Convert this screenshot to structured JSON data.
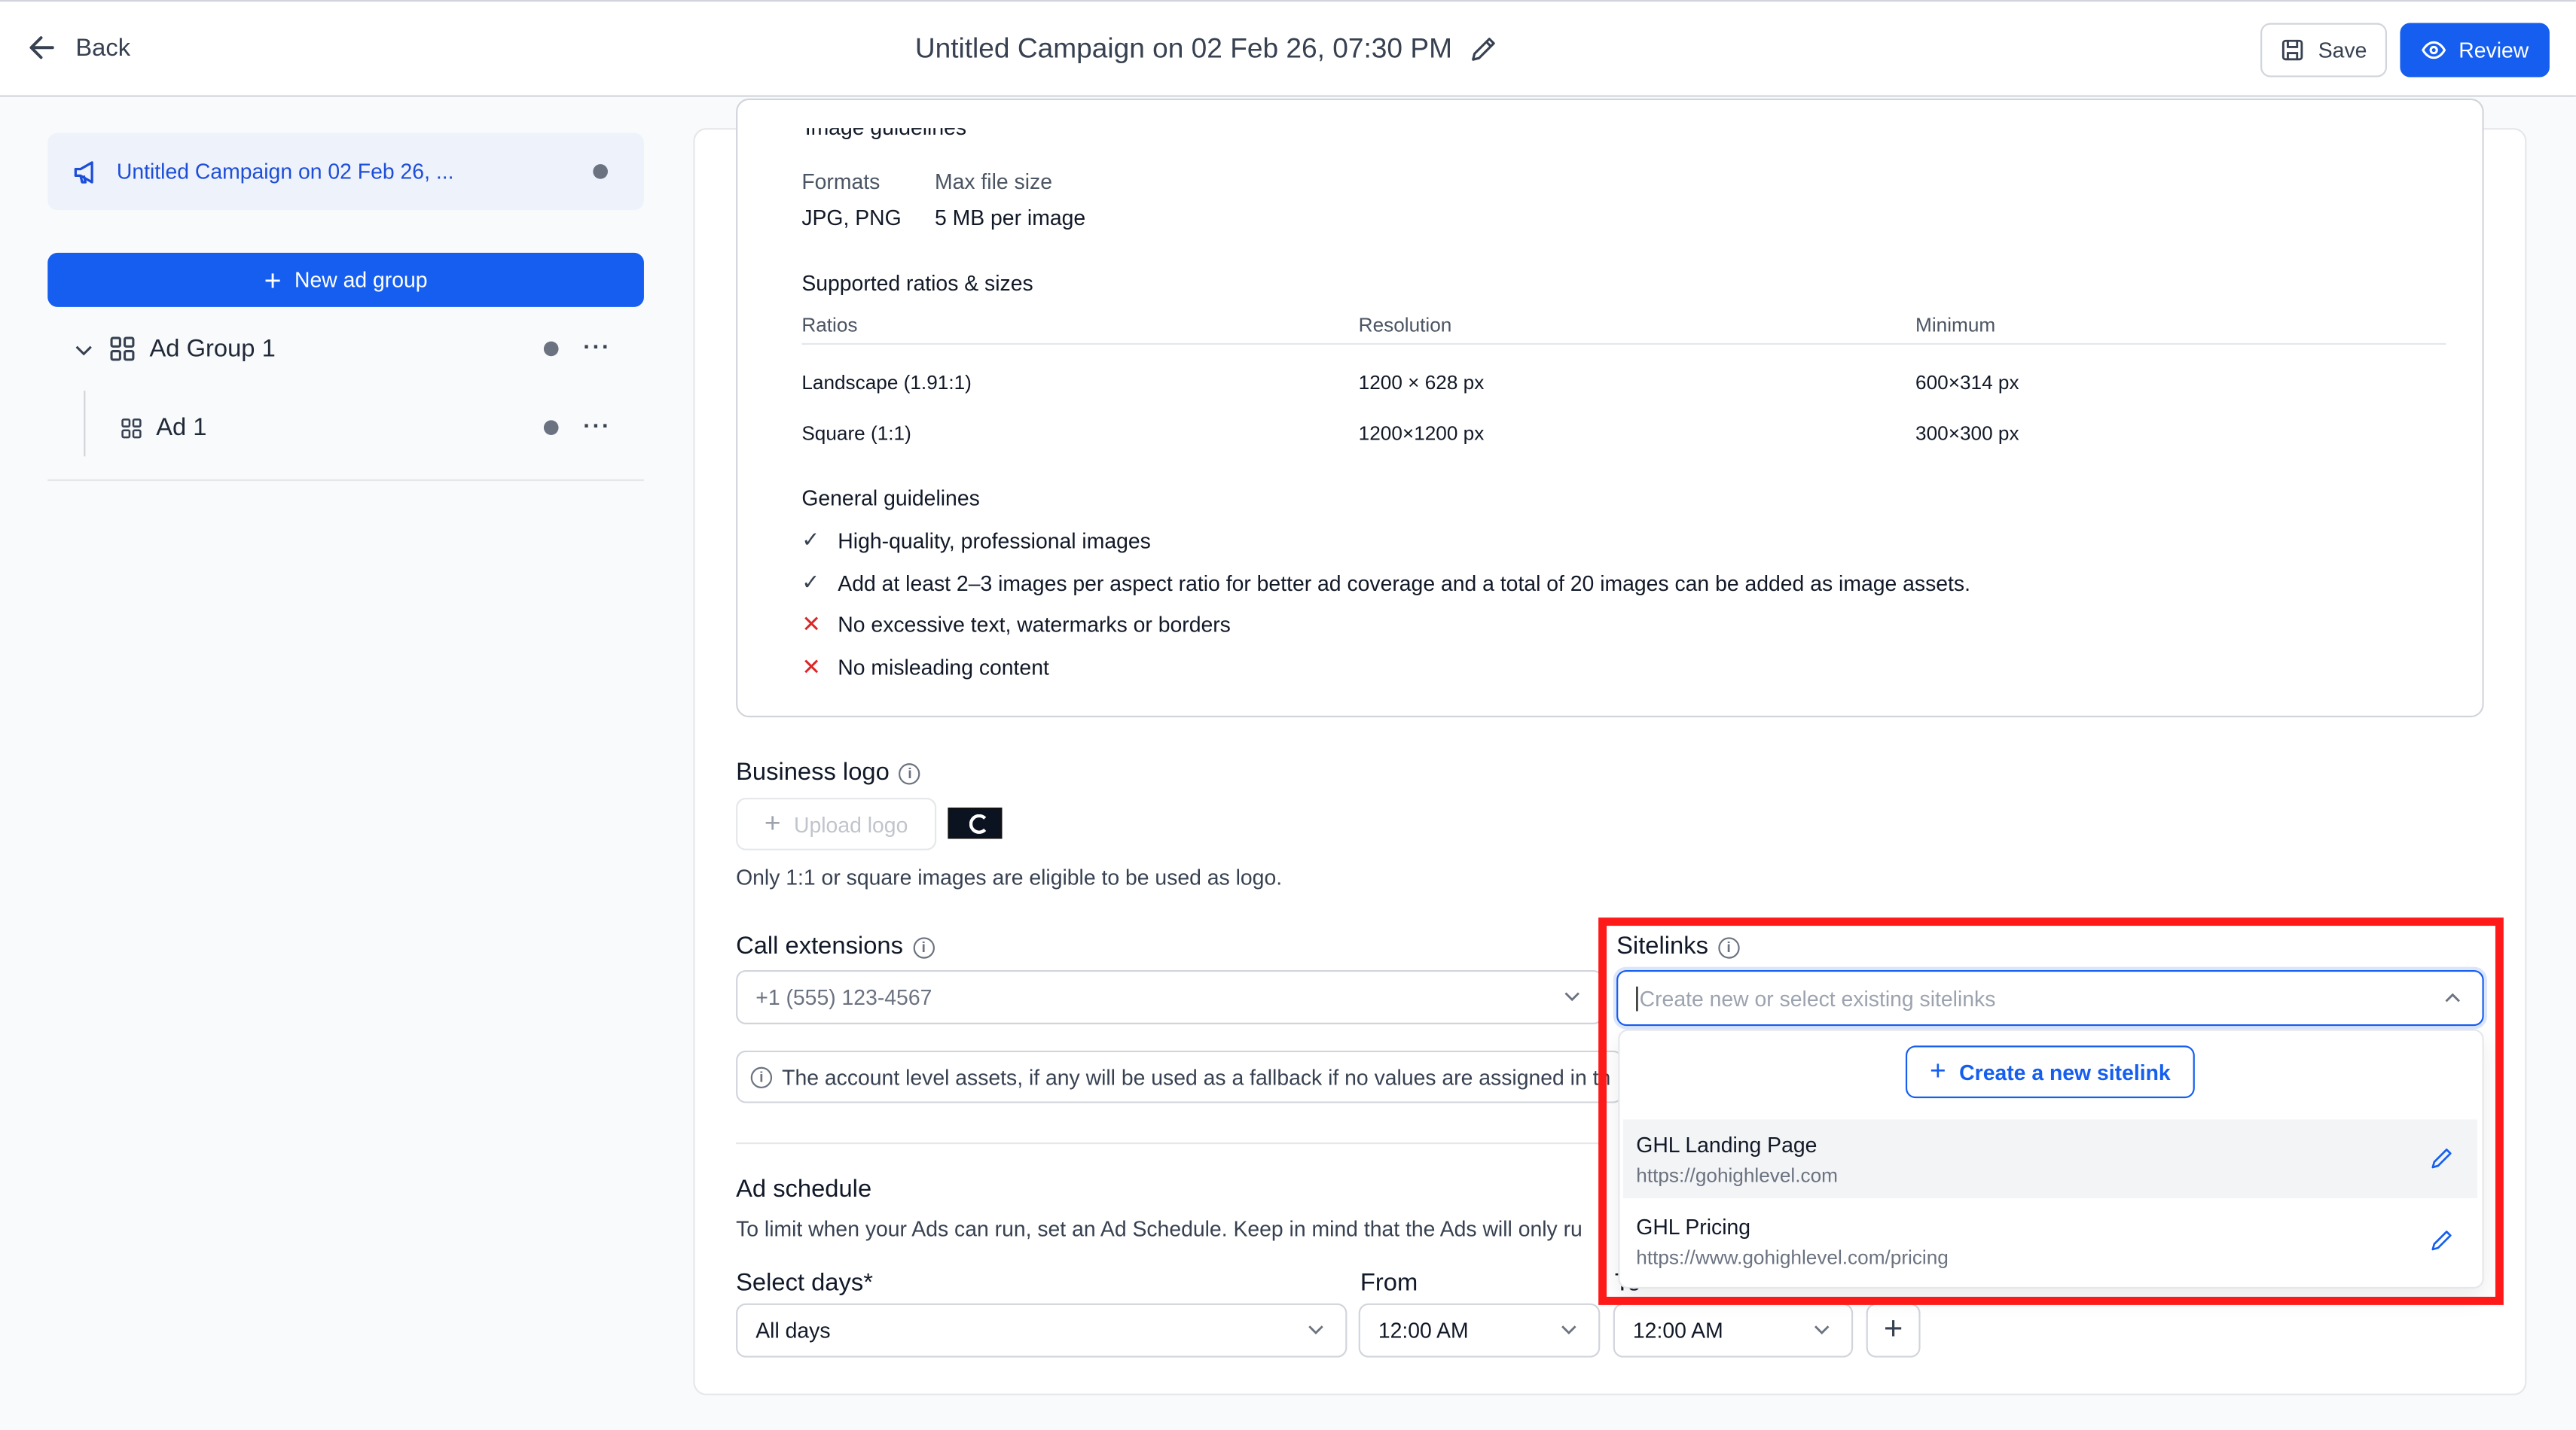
{
  "header": {
    "back_label": "Back",
    "title": "Untitled Campaign on 02 Feb 26, 07:30 PM",
    "save_label": "Save",
    "review_label": "Review",
    "accent_color": "#155eef"
  },
  "sidebar": {
    "campaign_label": "Untitled Campaign on 02 Feb 26, ...",
    "new_group_label": "New ad group",
    "ad_group_label": "Ad Group 1",
    "ad_label": "Ad 1",
    "more_label": "···"
  },
  "image_guidelines": {
    "partial_heading": "Image guidelines",
    "formats_label": "Formats",
    "formats_value": "JPG, PNG",
    "max_size_label": "Max file size",
    "max_size_value": "5 MB per image",
    "ratios_heading": "Supported ratios & sizes",
    "columns": [
      "Ratios",
      "Resolution",
      "Minimum"
    ],
    "rows": [
      [
        "Landscape (1.91:1)",
        "1200 × 628 px",
        "600×314 px"
      ],
      [
        "Square (1:1)",
        "1200×1200 px",
        "300×300 px"
      ]
    ],
    "general_heading": "General guidelines",
    "dos": [
      "High-quality, professional images",
      "Add at least 2–3 images per aspect ratio for better ad coverage and a total of 20 images can be added as image assets."
    ],
    "donts": [
      "No excessive text, watermarks or borders",
      "No misleading content"
    ]
  },
  "business_logo": {
    "heading": "Business logo",
    "upload_label": "Upload logo",
    "note": "Only 1:1 or square images are eligible to be used as logo."
  },
  "call_extensions": {
    "heading": "Call extensions",
    "placeholder": "+1 (555) 123-4567",
    "fallback_note": "The account level assets, if any will be used as a fallback if no values are assigned in th"
  },
  "sitelinks": {
    "heading": "Sitelinks",
    "placeholder": "Create new or select existing sitelinks",
    "create_label": "Create a new sitelink",
    "options": [
      {
        "name": "GHL Landing Page",
        "url": "https://gohighlevel.com"
      },
      {
        "name": "GHL Pricing",
        "url": "https://www.gohighlevel.com/pricing"
      }
    ],
    "highlight_color": "#ff1a1a"
  },
  "ad_schedule": {
    "heading": "Ad schedule",
    "description": "To limit when your Ads can run, set an Ad Schedule. Keep in mind that the Ads will only ru",
    "days_label": "Select days*",
    "days_value": "All days",
    "from_label": "From",
    "from_value": "12:00 AM",
    "to_label": "To",
    "to_value": "12:00 AM",
    "add_label": "+"
  }
}
